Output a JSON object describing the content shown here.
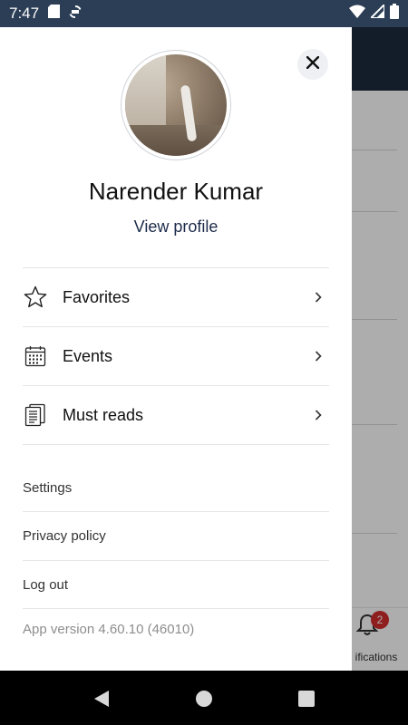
{
  "status_bar": {
    "time": "7:47",
    "left_icons": [
      "sd-card-icon",
      "sync-icon"
    ],
    "right_icons": [
      "wifi-icon",
      "signal-icon",
      "battery-icon"
    ]
  },
  "background": {
    "tab_label": "ifications",
    "notification_badge": "2"
  },
  "drawer": {
    "user_name": "Narender Kumar",
    "view_profile": "View profile",
    "menu": [
      {
        "label": "Favorites",
        "icon": "star-icon"
      },
      {
        "label": "Events",
        "icon": "calendar-icon"
      },
      {
        "label": "Must reads",
        "icon": "documents-icon"
      }
    ],
    "links": [
      {
        "label": "Settings"
      },
      {
        "label": "Privacy policy"
      },
      {
        "label": "Log out"
      }
    ],
    "version": "App version 4.60.10 (46010)"
  },
  "colors": {
    "status_bar": "#2c3e56",
    "app_header": "#1d2b3f",
    "link_blue": "#1c2b4a",
    "badge_red": "#d32f2f"
  }
}
